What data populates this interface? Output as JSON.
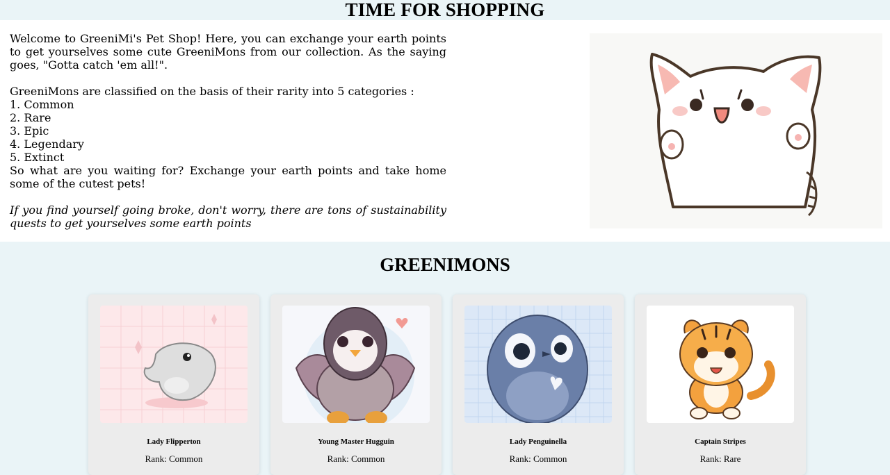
{
  "header": {
    "title": "TIME FOR SHOPPING"
  },
  "intro": {
    "welcome": "Welcome to GreeniMi's Pet Shop! Here, you can exchange your earth points to get yourselves some cute GreeniMons from our collection. As the saying goes, \"Gotta catch 'em all!\".",
    "classification": "GreeniMons are classified on the basis of their rarity into 5 categories :",
    "categories": [
      "1. Common",
      "2. Rare",
      "3. Epic",
      "4. Legendary",
      "5. Extinct"
    ],
    "cta": "So what are you waiting for? Exchange your earth points and take home some of the cutest pets!",
    "note": "If you find yourself going broke, don't worry, there are tons of sustainability quests to get yourselves some earth points"
  },
  "section": {
    "title": "GREENIMONS"
  },
  "cards": [
    {
      "name": "Lady Flipperton",
      "rank": "Rank: Common",
      "image": "seal-illustration"
    },
    {
      "name": "Young Master Hugguin",
      "rank": "Rank: Common",
      "image": "penguin-illustration"
    },
    {
      "name": "Lady Penguinella",
      "rank": "Rank: Common",
      "image": "blue-penguin-illustration"
    },
    {
      "name": "Captain Stripes",
      "rank": "Rank: Rare",
      "image": "tiger-illustration"
    }
  ],
  "colors": {
    "page_background": "#eaf4f7",
    "panel_background": "#ffffff",
    "card_background": "#ececec"
  }
}
